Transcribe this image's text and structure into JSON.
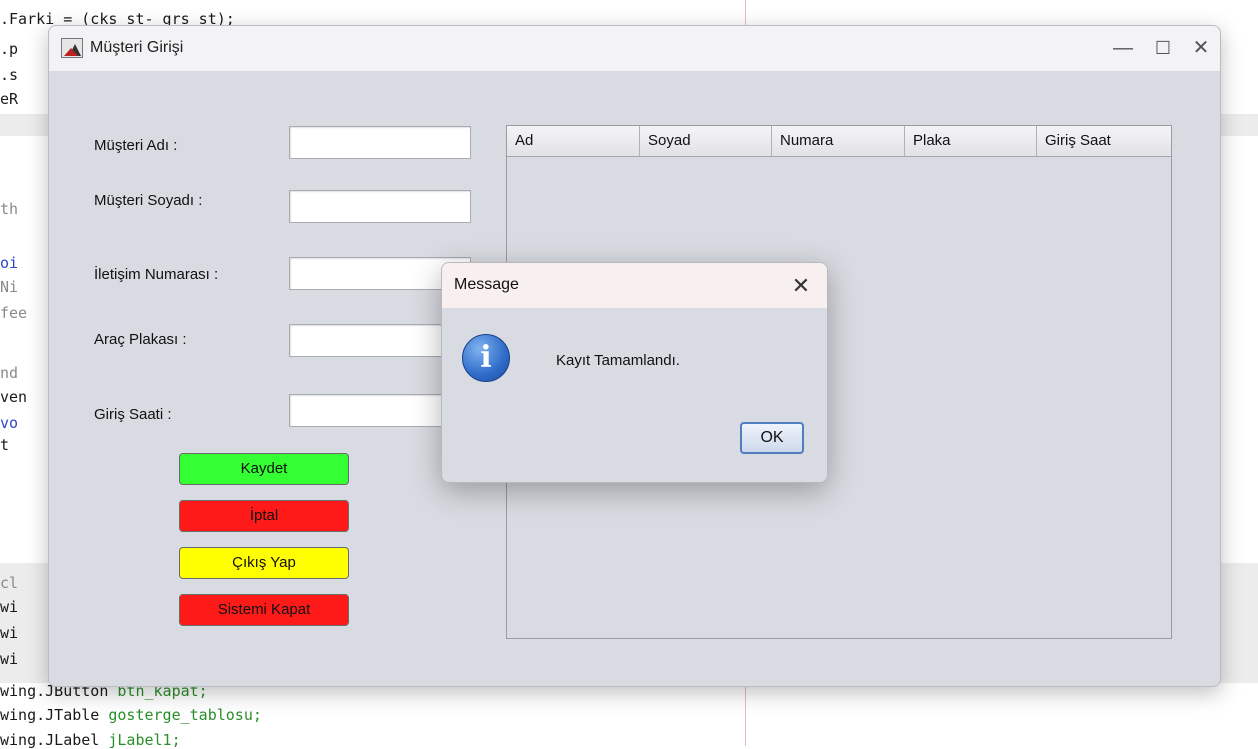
{
  "ide": {
    "lines": [
      {
        "text": ".Farki = (cks_st- grs_st);",
        "cls": ""
      },
      {
        "text": ".p",
        "cls": ""
      },
      {
        "text": ".s",
        "cls": ""
      },
      {
        "text": "eR",
        "cls": ""
      },
      {
        "text": "th",
        "cls": "gray"
      },
      {
        "text": "oi",
        "cls": "blue"
      },
      {
        "text": "Ni",
        "cls": "gray"
      },
      {
        "text": "fee",
        "cls": "gray"
      },
      {
        "text": "nd",
        "cls": "gray"
      },
      {
        "text": "ven",
        "cls": ""
      },
      {
        "text": "vo",
        "cls": "blue"
      },
      {
        "text": "t",
        "cls": ""
      },
      {
        "text": "cl",
        "cls": "gray"
      },
      {
        "text": "wi",
        "cls": ""
      },
      {
        "text": "wi",
        "cls": ""
      },
      {
        "text": "wi",
        "cls": ""
      },
      {
        "text": "wing.JButton ",
        "cls": "",
        "var": "btn_kapat;"
      },
      {
        "text": "wing.JTable ",
        "cls": "",
        "var": "gosterge_tablosu;"
      },
      {
        "text": "wing.JLabel ",
        "cls": "",
        "var": "jLabel1;"
      }
    ]
  },
  "window": {
    "title": "Müşteri Girişi",
    "minimize": "—",
    "maximize": "☐",
    "close": "✕"
  },
  "form": {
    "name_label": "Müşteri Adı :",
    "surname_label": "Müşteri Soyadı :",
    "phone_label": "İletişim Numarası :",
    "plate_label": "Araç Plakası :",
    "time_label": "Giriş Saati :",
    "name_value": "",
    "surname_value": "",
    "phone_value": "",
    "plate_value": "",
    "time_value": ""
  },
  "buttons": {
    "save": "Kaydet",
    "cancel": "İptal",
    "exit": "Çıkış Yap",
    "shutdown": "Sistemi Kapat"
  },
  "colors": {
    "save": "#33ff33",
    "cancel": "#ff1a1a",
    "exit": "#ffff00",
    "shutdown": "#ff1a1a"
  },
  "table": {
    "columns": [
      "Ad",
      "Soyad",
      "Numara",
      "Plaka",
      "Giriş Saat"
    ],
    "rows": []
  },
  "dialog": {
    "title": "Message",
    "close": "✕",
    "icon": "info-icon",
    "icon_glyph": "i",
    "message": "Kayıt Tamamlandı.",
    "ok": "OK"
  }
}
